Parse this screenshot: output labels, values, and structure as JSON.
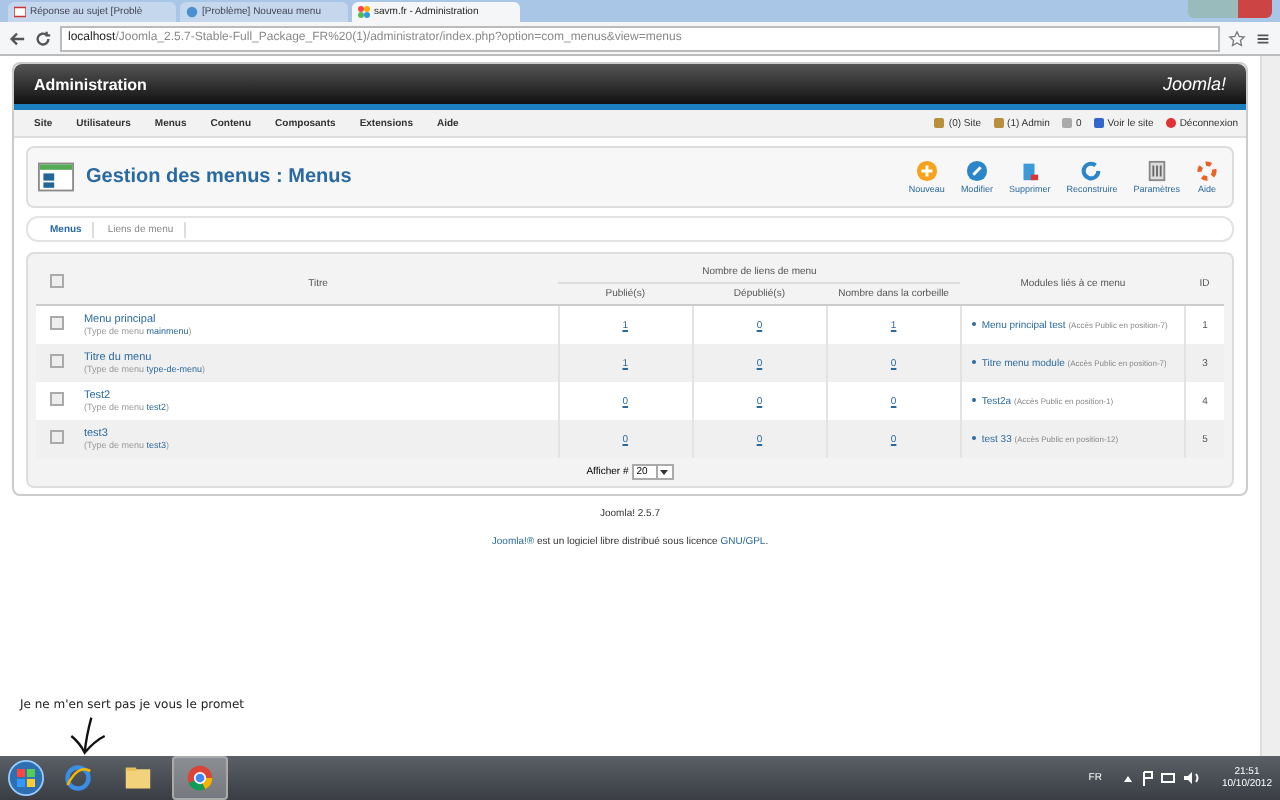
{
  "browser": {
    "tabs": [
      {
        "label": "Réponse au sujet [Problè",
        "selected": false,
        "kind": "mail"
      },
      {
        "label": "[Problème] Nouveau menu",
        "selected": false,
        "kind": "forum"
      },
      {
        "label": "savm.fr - Administration",
        "selected": true,
        "kind": "joomla"
      }
    ],
    "url_host": "localhost",
    "url_path": "/Joomla_2.5.7-Stable-Full_Package_FR%20(1)/administrator/index.php?option=com_menus&view=menus"
  },
  "header": {
    "title": "Administration",
    "logo": "Joomla!"
  },
  "menu": [
    "Site",
    "Utilisateurs",
    "Menus",
    "Contenu",
    "Composants",
    "Extensions",
    "Aide"
  ],
  "status": [
    {
      "label": "(0) Site",
      "kind": "user"
    },
    {
      "label": "(1) Admin",
      "kind": "user"
    },
    {
      "label": "0",
      "kind": "mail"
    },
    {
      "label": "Voir le site",
      "kind": "view"
    },
    {
      "label": "Déconnexion",
      "kind": "logout"
    }
  ],
  "page_title": "Gestion des menus : Menus",
  "toolbar": [
    {
      "label": "Nouveau",
      "kind": "new"
    },
    {
      "label": "Modifier",
      "kind": "edit"
    },
    {
      "label": "Supprimer",
      "kind": "delete"
    },
    {
      "label": "Reconstruire",
      "kind": "rebuild"
    },
    {
      "label": "Paramètres",
      "kind": "options"
    },
    {
      "label": "Aide",
      "kind": "help"
    }
  ],
  "subtabs": [
    {
      "label": "Menus",
      "selected": true
    },
    {
      "label": "Liens de menu",
      "selected": false
    }
  ],
  "table": {
    "select_all_checked": false,
    "title_col": "Titre",
    "group": "Nombre de liens de menu",
    "cols": [
      "Publié(s)",
      "Dépublié(s)",
      "Nombre dans la corbeille"
    ],
    "modules_col": "Modules liés à ce menu",
    "id_col": "ID",
    "rows": [
      {
        "checked": false,
        "title": "Menu principal",
        "type_prefix": "(Type de menu",
        "menu_type": "mainmenu",
        "type_suffix": ")",
        "counts": [
          "1",
          "0",
          "1"
        ],
        "module": "Menu principal test",
        "module_note": "(Accès Public en position-7)",
        "id": "1"
      },
      {
        "checked": false,
        "title": "Titre du menu",
        "type_prefix": "(Type de menu",
        "menu_type": "type-de-menu",
        "type_suffix": ")",
        "counts": [
          "1",
          "0",
          "0"
        ],
        "module": "Titre menu module",
        "module_note": "(Accès Public en position-7)",
        "id": "3"
      },
      {
        "checked": false,
        "title": "Test2",
        "type_prefix": "(Type de menu",
        "menu_type": "test2",
        "type_suffix": ")",
        "counts": [
          "0",
          "0",
          "0"
        ],
        "module": "Test2a",
        "module_note": "(Accès Public en position-1)",
        "id": "4"
      },
      {
        "checked": false,
        "title": "test3",
        "type_prefix": "(Type de menu",
        "menu_type": "test3",
        "type_suffix": ")",
        "counts": [
          "0",
          "0",
          "0"
        ],
        "module": "test 33",
        "module_note": "(Accès Public en position-12)",
        "id": "5"
      }
    ],
    "pager_label": "Afficher #",
    "pager_value": "20"
  },
  "footer": {
    "version": "Joomla! 2.5.7",
    "license_link1": "Joomla!®",
    "license_text": "est un logiciel libre distribué sous licence",
    "license_link2": "GNU/GPL",
    "license_end": "."
  },
  "annotation": "Je ne m'en sert pas je vous le promet",
  "taskbar": {
    "apps": [
      {
        "kind": "ie",
        "selected": false
      },
      {
        "kind": "folder",
        "selected": false
      },
      {
        "kind": "chrome",
        "selected": true
      }
    ],
    "lang": "FR",
    "time": "21:51",
    "date": "10/10/2012"
  }
}
